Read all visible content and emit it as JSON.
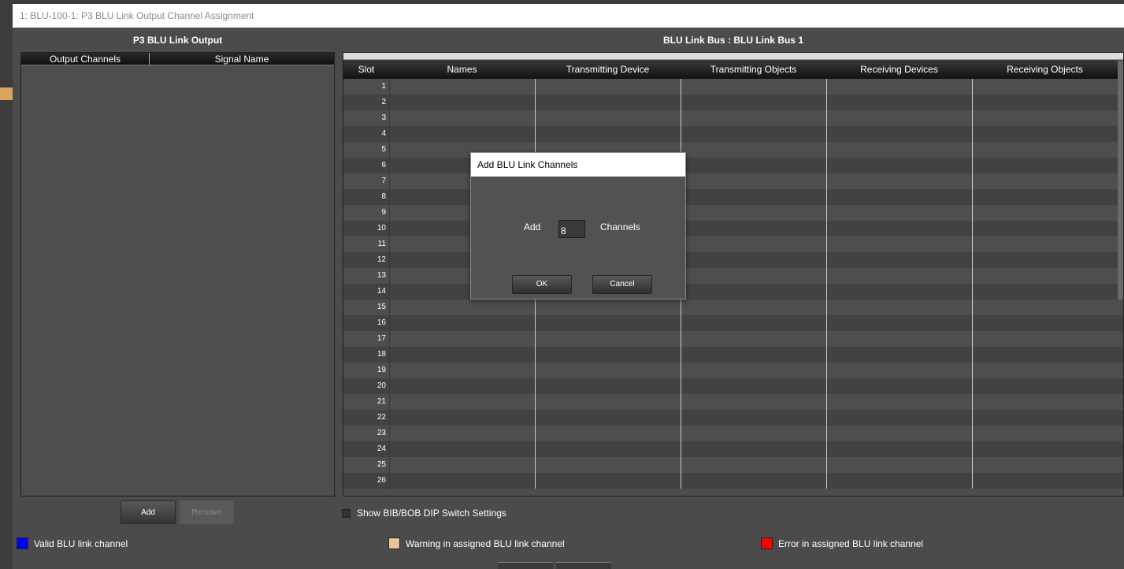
{
  "window": {
    "title": "1: BLU-100-1: P3 BLU Link Output Channel Assignment"
  },
  "left_panel": {
    "title": "P3 BLU Link Output",
    "columns": [
      "Output Channels",
      "Signal Name"
    ],
    "add_label": "Add",
    "remove_label": "Remove"
  },
  "right_panel": {
    "title": "BLU Link Bus : BLU Link Bus 1",
    "columns": [
      "Slot",
      "Names",
      "Transmitting Device",
      "Transmitting Objects",
      "Receiving Devices",
      "Receiving Objects"
    ],
    "slots": [
      "1",
      "2",
      "3",
      "4",
      "5",
      "6",
      "7",
      "8",
      "9",
      "10",
      "11",
      "12",
      "13",
      "14",
      "15",
      "16",
      "17",
      "18",
      "19",
      "20",
      "21",
      "22",
      "23",
      "24",
      "25",
      "26"
    ]
  },
  "show_dip": {
    "label": "Show BIB/BOB DIP Switch Settings",
    "checked": false
  },
  "legend": [
    {
      "label": "Valid BLU link channel",
      "color": "#0000ff"
    },
    {
      "label": "Warning in assigned BLU link channel",
      "color": "#e8c39a"
    },
    {
      "label": "Error in assigned BLU link channel",
      "color": "#ff0000"
    }
  ],
  "dialog": {
    "title": "Add BLU Link Channels",
    "add_label": "Add",
    "count_value": "8",
    "channels_label": "Channels",
    "ok_label": "OK",
    "cancel_label": "Cancel"
  }
}
